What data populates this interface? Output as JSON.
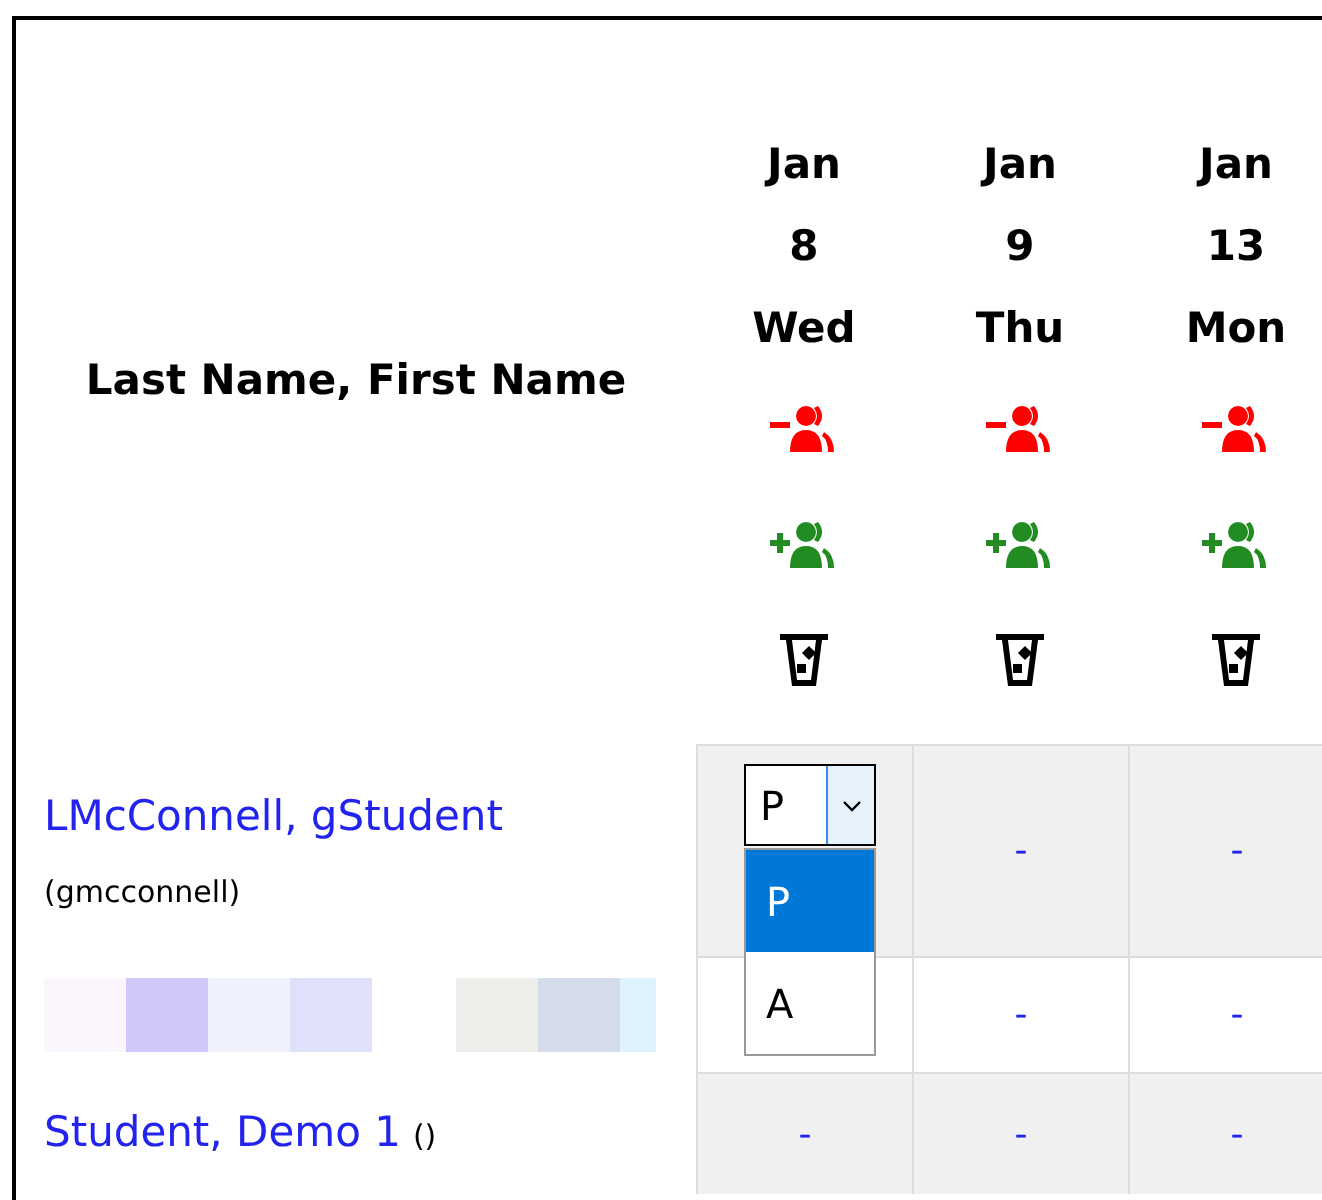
{
  "header": {
    "name_column": "Last Name, First Name"
  },
  "dates": [
    {
      "month": "Jan",
      "day": "8",
      "weekday": "Wed"
    },
    {
      "month": "Jan",
      "day": "9",
      "weekday": "Thu"
    },
    {
      "month": "Jan",
      "day": "13",
      "weekday": "Mon"
    }
  ],
  "rows": [
    {
      "kind": "named",
      "name": "LMcConnell, gStudent",
      "username": "(gmcconnell)",
      "cells": [
        {
          "kind": "select",
          "value": "P",
          "expanded": true,
          "options": [
            {
              "label": "P",
              "selected": true
            },
            {
              "label": "A",
              "selected": false
            }
          ]
        },
        {
          "kind": "text",
          "text": "-"
        },
        {
          "kind": "text",
          "text": "-"
        }
      ]
    },
    {
      "kind": "redacted",
      "cells": [
        {
          "kind": "hidden"
        },
        {
          "kind": "text",
          "text": "-"
        },
        {
          "kind": "text",
          "text": "-"
        }
      ]
    },
    {
      "kind": "named",
      "name": "Student, Demo 1",
      "username": "()",
      "cells": [
        {
          "kind": "text",
          "text": "-"
        },
        {
          "kind": "text",
          "text": "-"
        },
        {
          "kind": "text",
          "text": "-"
        }
      ]
    }
  ]
}
